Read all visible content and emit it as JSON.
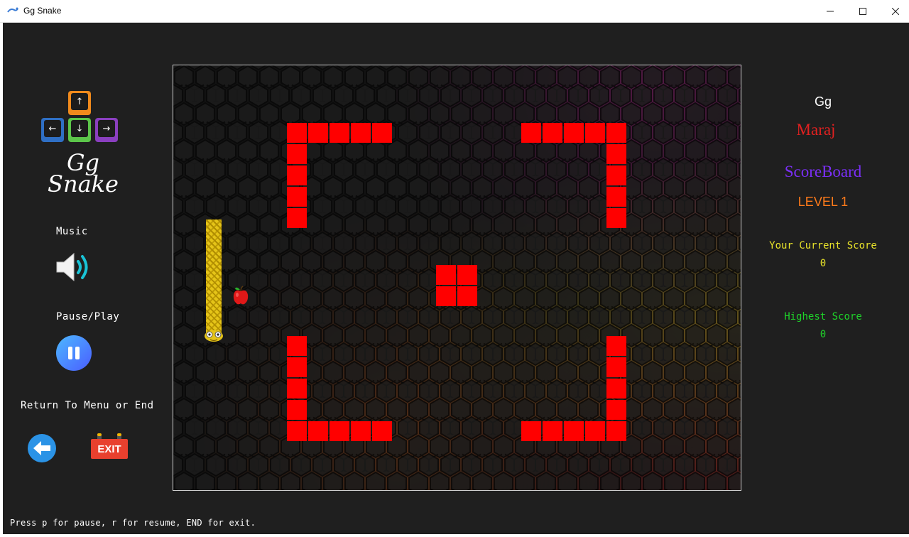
{
  "window": {
    "title": "Gg Snake"
  },
  "left_panel": {
    "logo_line1": "Gg",
    "logo_line2": "Snake",
    "keys": {
      "up": "↑",
      "left": "←",
      "down": "↓",
      "right": "→"
    },
    "music_label": "Music",
    "pause_label": "Pause/Play",
    "return_label": "Return To Menu or End",
    "exit_label": "EXIT"
  },
  "right_panel": {
    "player_first": "Gg",
    "player_last": "Maraj",
    "scoreboard": "ScoreBoard",
    "level": "LEVEL 1",
    "current_score_label": "Your Current Score",
    "current_score": "0",
    "highest_score_label": "Highest Score",
    "highest_score": "0"
  },
  "status_bar": "Press p for pause, r for resume, END for exit.",
  "colors": {
    "wall": "#ff0000",
    "player_first": "#ffffff",
    "player_last": "#e02020",
    "scoreboard": "#7b2ff7",
    "level": "#ff7a1a",
    "current_score": "#e8e32a",
    "highest_score": "#1fd42a"
  },
  "icons": {
    "music": "speaker-icon",
    "pause": "pause-icon",
    "back": "arrow-left-icon",
    "exit": "exit-sign-icon"
  }
}
